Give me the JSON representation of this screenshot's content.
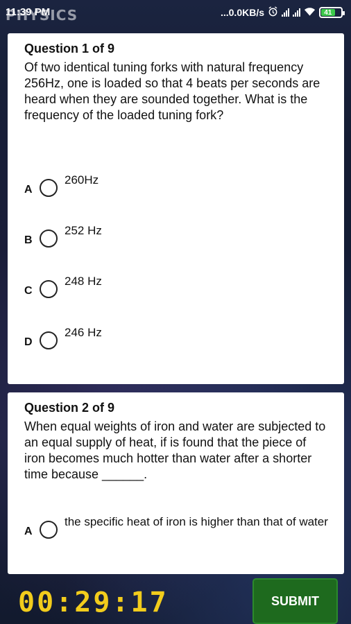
{
  "status_bar": {
    "app_title": "PHYSICS",
    "time": "11:39 PM",
    "network_speed": "...0.0KB/s",
    "alarm_icon": "alarm-clock-icon",
    "signal_icon": "signal-bars-icon",
    "wifi_icon": "wifi-icon",
    "battery_level": "41"
  },
  "questions": [
    {
      "number": "Question 1 of 9",
      "text": "Of two identical tuning forks with natural frequency 256Hz, one is loaded so that 4 beats per seconds are heard when they are sounded together. What is the frequency of the loaded tuning fork?",
      "options": [
        {
          "letter": "A",
          "text": "260Hz"
        },
        {
          "letter": "B",
          "text": "252 Hz"
        },
        {
          "letter": "C",
          "text": "248 Hz"
        },
        {
          "letter": "D",
          "text": "246 Hz"
        }
      ]
    },
    {
      "number": "Question 2 of 9",
      "text": "When equal weights of iron and water are subjected to an equal supply of heat, if is found that the piece of iron becomes much hotter than water after a shorter time because ______.",
      "options": [
        {
          "letter": "A",
          "text": "the specific heat of iron is higher than that of water"
        }
      ]
    }
  ],
  "footer": {
    "timer": "00:29:17",
    "submit_label": "SUBMIT"
  },
  "colors": {
    "timer": "#f2cc1c",
    "submit_bg": "#1e6a1e",
    "battery": "#3cc94a"
  }
}
